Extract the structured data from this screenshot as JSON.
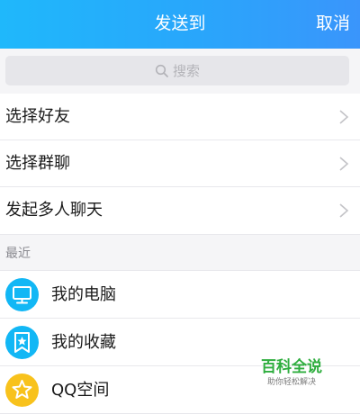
{
  "header": {
    "title": "发送到",
    "cancel_label": "取消",
    "gradient_start": "#1fb8fb",
    "gradient_end": "#3a95fb"
  },
  "search": {
    "placeholder": "搜索",
    "icon": "search-icon"
  },
  "menu": {
    "items": [
      {
        "label": "选择好友",
        "icon": "chevron-right-icon"
      },
      {
        "label": "选择群聊",
        "icon": "chevron-right-icon"
      },
      {
        "label": "发起多人聊天",
        "icon": "chevron-right-icon"
      }
    ]
  },
  "recent": {
    "section_label": "最近",
    "items": [
      {
        "label": "我的电脑",
        "icon": "monitor-icon",
        "color": "#12b7f5"
      },
      {
        "label": "我的收藏",
        "icon": "favorites-star-icon",
        "color": "#12b7f5"
      },
      {
        "label": "QQ空间",
        "icon": "qzone-star-icon",
        "color": "#f8c21c"
      }
    ]
  },
  "watermark": {
    "title": "百科全说",
    "subtitle": "助你轻松解决"
  }
}
